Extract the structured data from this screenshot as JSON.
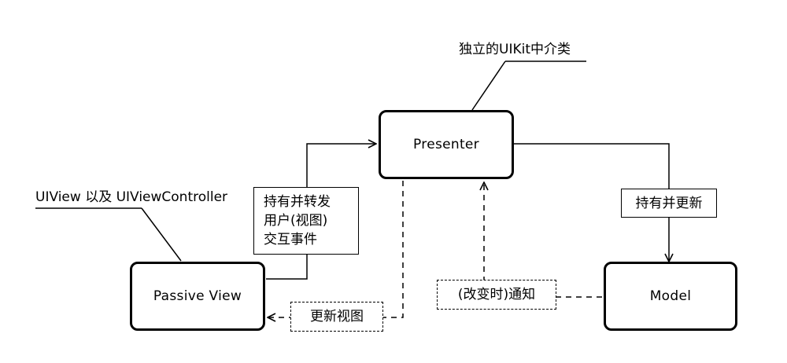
{
  "nodes": {
    "presenter": "Presenter",
    "passive_view": "Passive View",
    "model": "Model"
  },
  "notes": {
    "presenter_note": "独立的UIKit中介类",
    "view_note": "UIView 以及 UIViewController"
  },
  "edge_labels": {
    "forward_interaction": [
      "持有并转发",
      "用户(视图)",
      "交互事件"
    ],
    "hold_update": "持有并更新",
    "update_view": "更新视图",
    "notify_change": "(改变时)通知"
  }
}
